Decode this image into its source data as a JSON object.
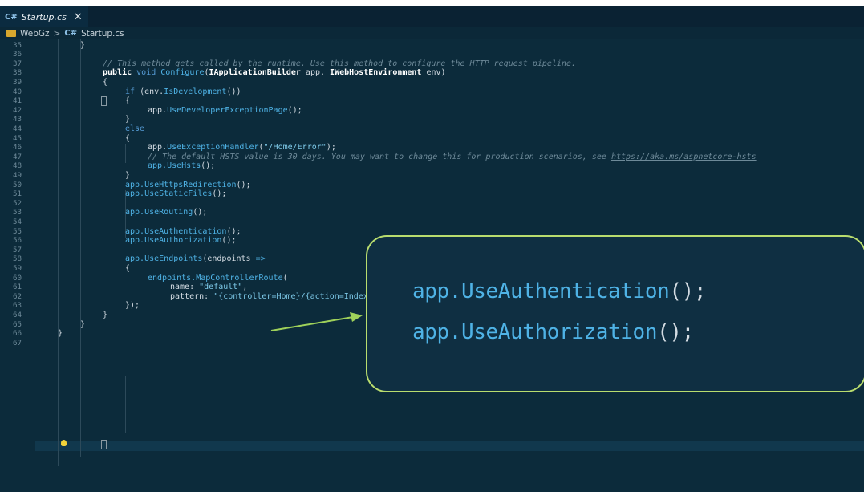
{
  "tab": {
    "icon": "C#",
    "title": "Startup.cs",
    "close": "✕"
  },
  "breadcrumb": {
    "folder_icon": "folder-icon",
    "project": "WebGz",
    "separator": ">",
    "file_icon": "C#",
    "file": "Startup.cs"
  },
  "line_numbers": [
    "35",
    "36",
    "37",
    "38",
    "39",
    "40",
    "41",
    "42",
    "43",
    "44",
    "45",
    "46",
    "47",
    "48",
    "49",
    "50",
    "51",
    "52",
    "53",
    "54",
    "55",
    "56",
    "57",
    "58",
    "59",
    "60",
    "61",
    "62",
    "63",
    "64",
    "65",
    "66",
    "67"
  ],
  "code": {
    "l35": "}",
    "l37": "// This method gets called by the runtime. Use this method to configure the HTTP request pipeline.",
    "l38_public": "public",
    "l38_void": "void",
    "l38_name": "Configure",
    "l38_type1": "IApplicationBuilder",
    "l38_arg1": "app,",
    "l38_type2": "IWebHostEnvironment",
    "l38_arg2": "env)",
    "l40_if": "if",
    "l40_obj": "(env.",
    "l40_fn": "IsDevelopment",
    "l40_end": "())",
    "l42_obj": "app.",
    "l42_fn": "UseDeveloperExceptionPage",
    "l42_end": "();",
    "l44": "else",
    "l46_obj": "app.",
    "l46_fn": "UseExceptionHandler",
    "l46_str": "\"/Home/Error\"",
    "l47_comment": "// The default HSTS value is 30 days. You may want to change this for production scenarios, see ",
    "l47_link": "https://aka.ms/aspnetcore-hsts",
    "l48_fn": "UseHsts",
    "l50_fn": "UseHttpsRedirection",
    "l51_fn": "UseStaticFiles",
    "l53_fn": "UseRouting",
    "l55_fn": "UseAuthentication",
    "l56_fn": "UseAuthorization",
    "l58_fn": "UseEndpoints",
    "l58_arg": "(endpoints",
    "l58_arrow": "=>",
    "l60_obj": "endpoints.",
    "l60_fn": "MapControllerRoute",
    "l61_key": "name:",
    "l61_val": "\"default\"",
    "l62_key": "pattern:",
    "l62_val": "\"{controller=Home}/{action=Index}/{id?}\"",
    "l63": "});",
    "open_brace": "{",
    "close_brace": "}",
    "app": "app.",
    "call_end": "();",
    "paren_open": "(",
    "paren_close": ");",
    "comma": ","
  },
  "callout": {
    "line1": "app.UseAuthentication();",
    "line2": "app.UseAuthorization();"
  },
  "colors": {
    "editor_bg": "#0c2b3b",
    "callout_border": "#b9dd6e",
    "arrow": "#9fd15a"
  }
}
